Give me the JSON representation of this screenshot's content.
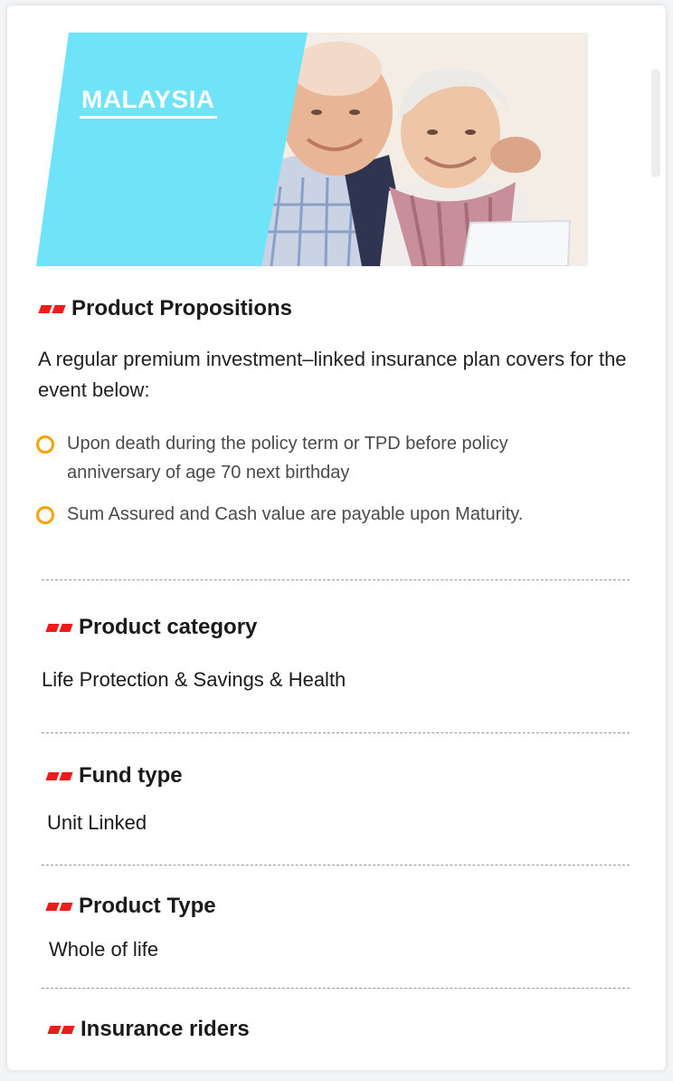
{
  "banner": {
    "title": "MALAYSIA",
    "image_alt": "elderly couple smiling"
  },
  "propositions": {
    "heading": "Product Propositions",
    "intro": "A regular premium investment–linked insurance plan covers for the event below:",
    "bullets": [
      "Upon death during the policy term or TPD before policy anniversary of age 70 next birthday",
      "Sum Assured and Cash value are payable upon Maturity."
    ]
  },
  "category": {
    "heading": "Product category",
    "value": "Life Protection & Savings & Health"
  },
  "fund_type": {
    "heading": "Fund type",
    "value": "Unit Linked"
  },
  "product_type": {
    "heading": "Product Type",
    "value": "Whole of life"
  },
  "riders": {
    "heading": "Insurance riders"
  },
  "colors": {
    "accent_cyan": "#6fe4f8",
    "bullet_ring": "#f5a300",
    "heading_bars": "#ee1b1b"
  }
}
